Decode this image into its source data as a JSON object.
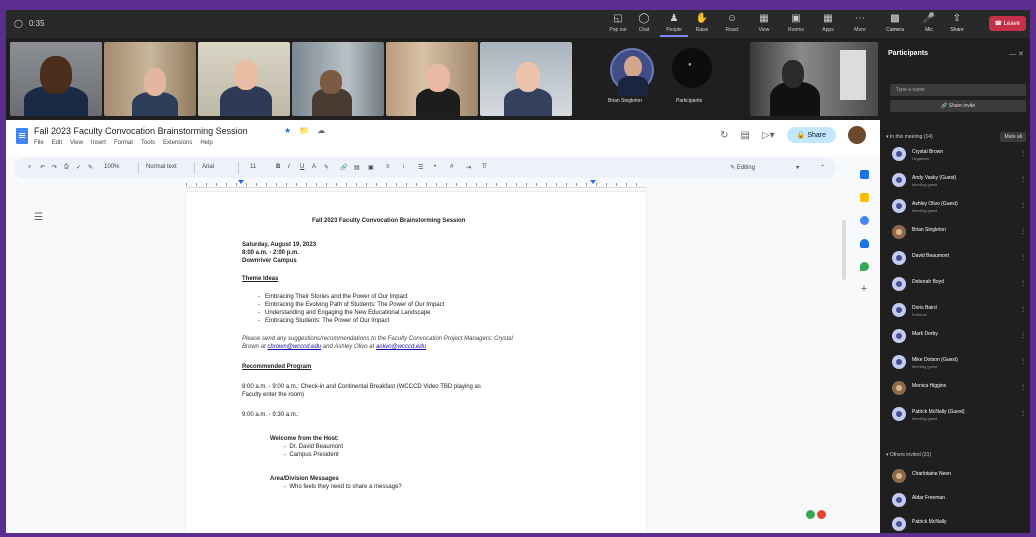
{
  "teams": {
    "window_title": "0:35",
    "toolbar": [
      {
        "label": "Pop out",
        "icon": "popout-icon"
      },
      {
        "label": "Chat",
        "icon": "chat-icon"
      },
      {
        "label": "People",
        "icon": "people-icon"
      },
      {
        "label": "Raise",
        "icon": "raise-hand-icon"
      },
      {
        "label": "React",
        "icon": "react-icon"
      },
      {
        "label": "View",
        "icon": "view-icon"
      },
      {
        "label": "Rooms",
        "icon": "rooms-icon"
      },
      {
        "label": "Apps",
        "icon": "apps-icon"
      },
      {
        "label": "More",
        "icon": "more-icon"
      }
    ],
    "controls": [
      {
        "label": "Camera",
        "icon": "camera-icon"
      },
      {
        "label": "Mic",
        "icon": "mic-icon"
      },
      {
        "label": "Share",
        "icon": "share-screen-icon"
      }
    ],
    "leave_label": "Leave",
    "gallery_names": [
      "Brian Singleton",
      "Participants"
    ]
  },
  "docs": {
    "title": "Fall 2023 Faculty Convocation Brainstorming Session",
    "menu": [
      "File",
      "Edit",
      "View",
      "Insert",
      "Format",
      "Tools",
      "Extensions",
      "Help"
    ],
    "share_label": "Share",
    "toolbar": {
      "zoom": "100%",
      "style": "Normal text",
      "font": "Arial",
      "size": "11",
      "mode": "Editing"
    },
    "page": {
      "heading": "Fall 2023 Faculty Convocation Brainstorming Session",
      "date_line": "Saturday, August 19, 2023",
      "time_line": "8:00 a.m. - 2:00 p.m.",
      "location_line": "Downriver Campus",
      "theme_heading": "Theme Ideas",
      "themes": [
        "Embracing Their Stories and the Power of Our Impact",
        "Embracing the Evolving Path of Students: The Power of Our Impact",
        "Understanding and Engaging the New Educational Landscape",
        "Embracing Students: The Power of Our Impact"
      ],
      "note_line1": "Please send any suggestions/recommendations to the Faculty Convocation Project Managers: Crystal",
      "note_line2_pre": "Brown at ",
      "note_link1": "cbrown@wcccd.edu",
      "note_mid": " and Ashley Olivo at ",
      "note_link2": "aolivo@wcccd.edu",
      "program_heading": "Recommended Program",
      "program_line1": "8:00 a.m. - 9:00 a.m.: Check-in and Continental Breakfast (WCCCD Video TBD playing as",
      "program_line2": "Faculty enter the room)",
      "program_line3": "9:00 a.m. - 9:30 a.m.:",
      "welcome_heading": "Welcome from the Host:",
      "welcome_items": [
        "Dr. David Beaumont",
        "Campus President"
      ],
      "announce_heading": "Area/Division Messages",
      "announce_items": [
        "Who feels they need to share a message?"
      ]
    }
  },
  "participants": {
    "title": "Participants",
    "search_placeholder": "Type a name",
    "invite_label": "Share invite",
    "in_meeting_label": "In this meeting (14)",
    "mute_all_label": "Mute all",
    "others_label": "Others invited (31)",
    "people": [
      {
        "name": "Crystal Brown",
        "role": "Organizer"
      },
      {
        "name": "Andy Vasky (Guest)",
        "role": "Meeting guest"
      },
      {
        "name": "Ashley Olivo (Guest)",
        "role": "Meeting guest"
      },
      {
        "name": "Brian Singleton",
        "role": ""
      },
      {
        "name": "David Beaumont",
        "role": ""
      },
      {
        "name": "Deborah Boyd",
        "role": ""
      },
      {
        "name": "Doris Baird",
        "role": "External"
      },
      {
        "name": "Mark Derby",
        "role": ""
      },
      {
        "name": "Mike Dotson (Guest)",
        "role": "Meeting guest"
      },
      {
        "name": "Monica Higgins",
        "role": ""
      },
      {
        "name": "Patrick McNally (Guest)",
        "role": "Meeting guest"
      }
    ],
    "others": [
      {
        "name": "Charlotaine Neen"
      },
      {
        "name": "Aldar Freeman"
      },
      {
        "name": "Patrick McNally"
      }
    ]
  }
}
